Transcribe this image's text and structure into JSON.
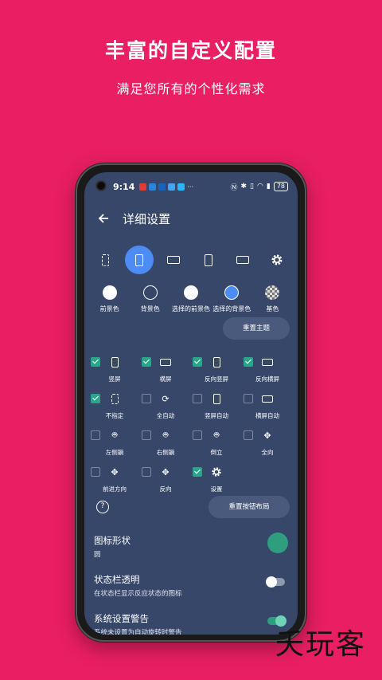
{
  "promo": {
    "headline": "丰富的自定义配置",
    "subline": "满足您所有的个性化需求"
  },
  "statusbar": {
    "time": "9:14",
    "battery": "78"
  },
  "appbar": {
    "back_icon": "arrow-back-icon",
    "title": "详细设置"
  },
  "orientation_tabs": [
    {
      "icon": "dashed-rect-icon",
      "active": false
    },
    {
      "icon": "portrait-phone-icon",
      "active": true
    },
    {
      "icon": "landscape-icon",
      "active": false
    },
    {
      "icon": "reverse-portrait-icon",
      "active": false
    },
    {
      "icon": "reverse-landscape-icon",
      "active": false
    },
    {
      "icon": "gear-icon",
      "active": false
    }
  ],
  "colors": [
    {
      "label": "前景色",
      "color": "#FFFFFF",
      "outline": false
    },
    {
      "label": "背景色",
      "color": "#36476A",
      "outline": true
    },
    {
      "label": "选择的前景色",
      "color": "#FFFFFF",
      "outline": false
    },
    {
      "label": "选择的背景色",
      "color": "#4D8BF5",
      "outline": false
    },
    {
      "label": "基色",
      "color": "checker",
      "outline": false
    }
  ],
  "reset_theme_label": "重置主题",
  "modes": [
    [
      {
        "label": "竖屏",
        "checked": true
      },
      {
        "label": "横屏",
        "checked": true
      },
      {
        "label": "反向竖屏",
        "checked": true
      },
      {
        "label": "反向横屏",
        "checked": true
      }
    ],
    [
      {
        "label": "不指定",
        "checked": true
      },
      {
        "label": "全自动",
        "checked": false
      },
      {
        "label": "竖屏自动",
        "checked": false
      },
      {
        "label": "横屏自动",
        "checked": false
      }
    ],
    [
      {
        "label": "左侧躺",
        "checked": false
      },
      {
        "label": "右侧躺",
        "checked": false
      },
      {
        "label": "倒立",
        "checked": false
      },
      {
        "label": "全向",
        "checked": false
      }
    ],
    [
      {
        "label": "前进方向",
        "checked": false
      },
      {
        "label": "反向",
        "checked": false
      },
      {
        "label": "设置",
        "checked": true
      }
    ]
  ],
  "reset_layout_label": "重置按钮布局",
  "settings": {
    "icon_shape": {
      "title": "图标形状",
      "value": "圆"
    },
    "statusbar_transparent": {
      "title": "状态栏透明",
      "subtitle": "在状态栏显示反应状态的图标",
      "on": false
    },
    "system_warning": {
      "title": "系统设置警告",
      "subtitle": "系统未设置为自动旋转时警告",
      "on": true
    }
  },
  "watermark": "夭玩客"
}
